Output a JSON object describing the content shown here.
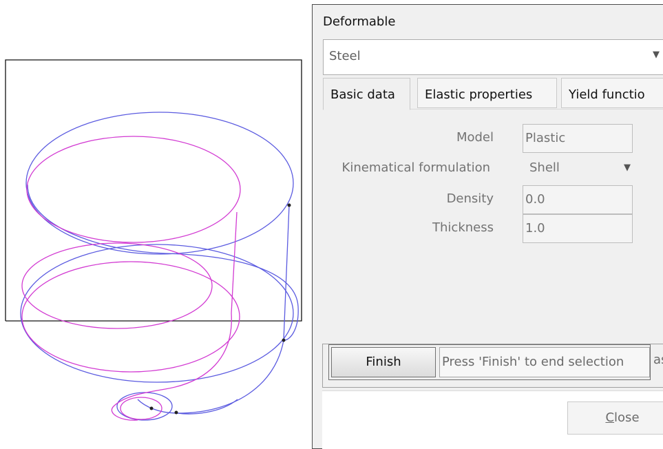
{
  "dialog": {
    "title": "Deformable",
    "material_combo": {
      "value": "Steel"
    },
    "tabs": [
      {
        "label": "Basic data",
        "active": true
      },
      {
        "label": "Elastic properties",
        "active": false
      },
      {
        "label": "Yield functio",
        "active": false
      }
    ],
    "basic": {
      "model_label": "Model",
      "model_value": "Plastic",
      "kinematic_label": "Kinematical formulation",
      "kinematic_value": "Shell",
      "density_label": "Density",
      "density_value": "0.0",
      "thickness_label": "Thickness",
      "thickness_value": "1.0"
    },
    "selection": {
      "finish_label": "Finish",
      "hint": "Press 'Finish' to end selection",
      "overflow_text": "as"
    },
    "close_label": "Close"
  },
  "viewport": {
    "curve_colors": {
      "blue": "#5a5ae0",
      "magenta": "#d23ad2"
    }
  }
}
